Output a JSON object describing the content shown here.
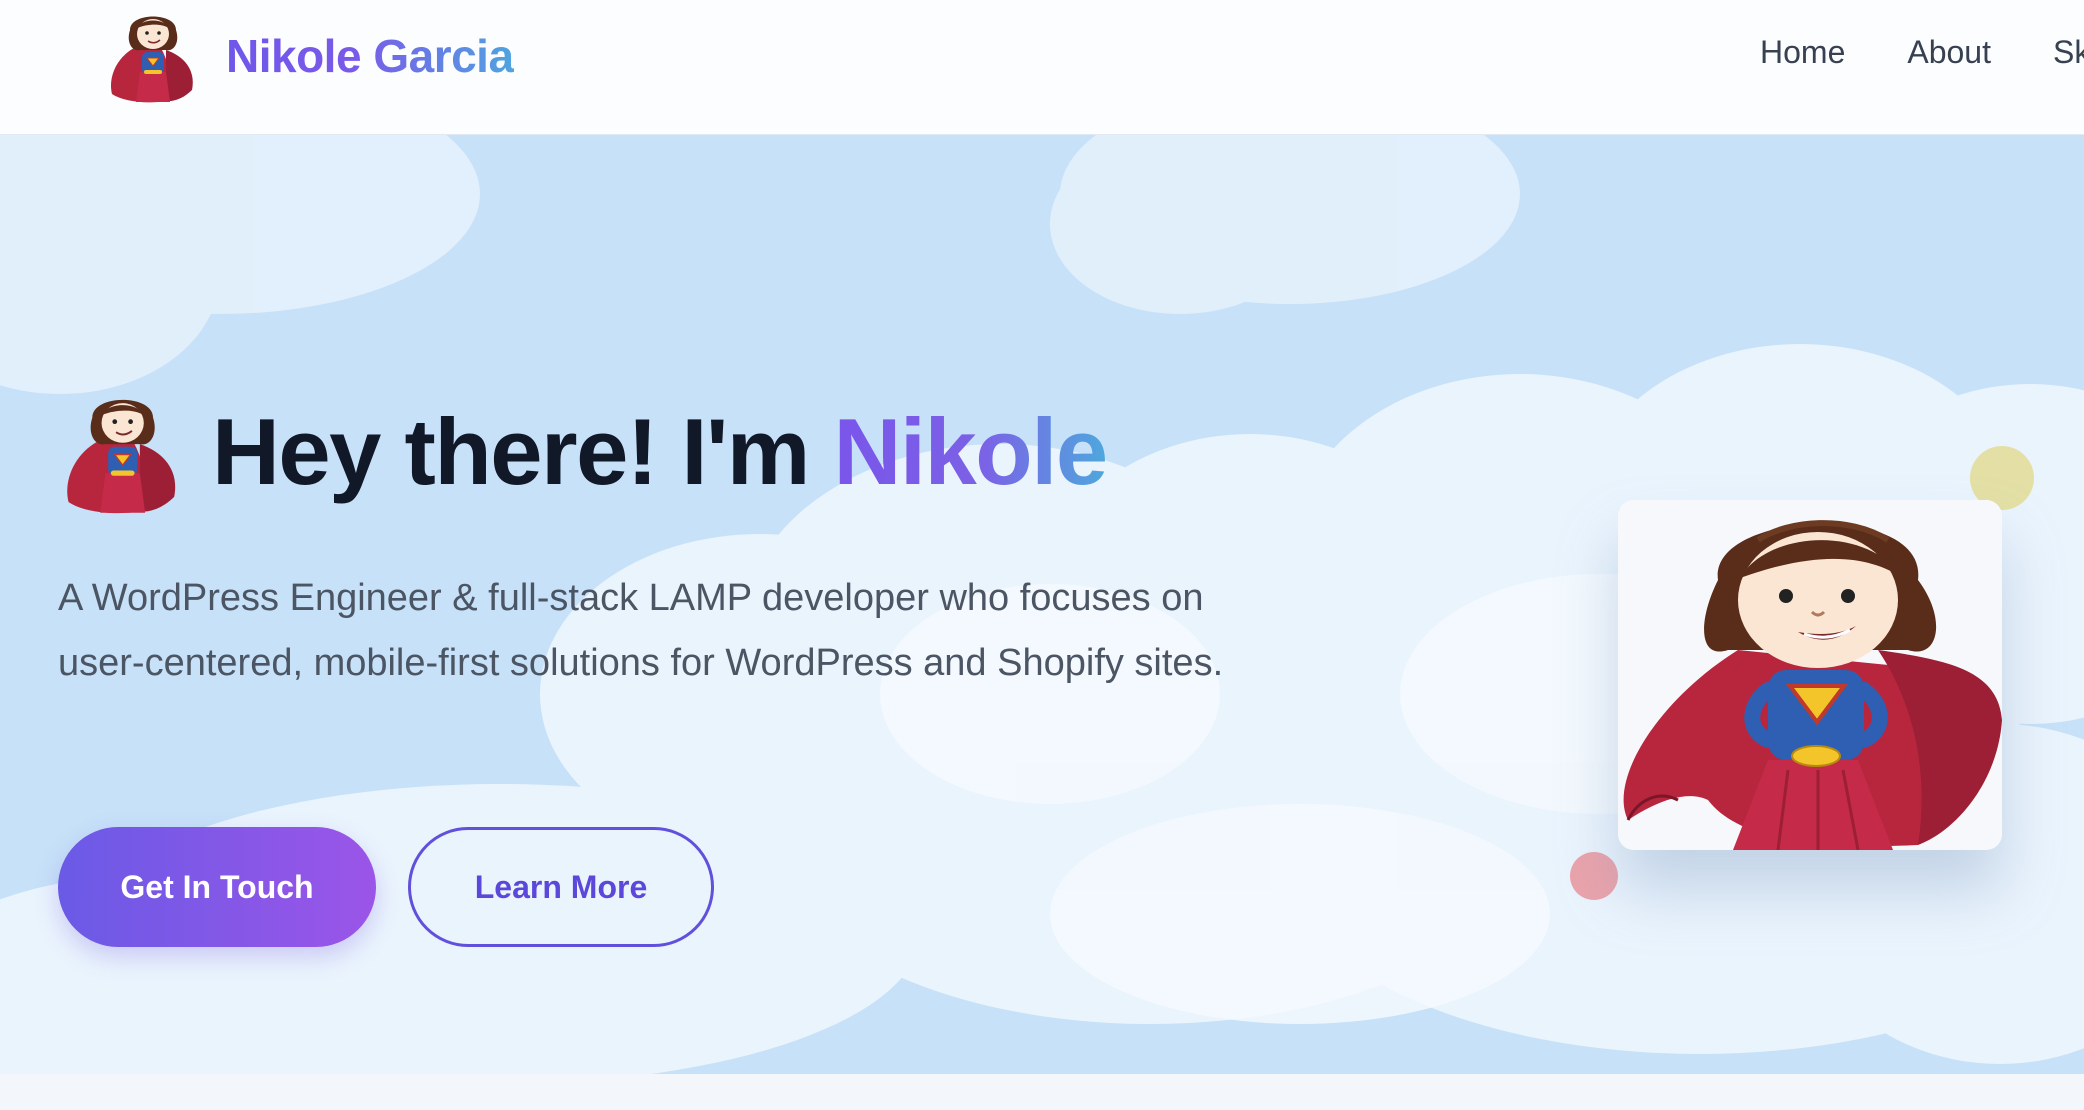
{
  "header": {
    "brand_name": "Nikole Garcia",
    "logo_icon": "superhero-mascot-icon",
    "nav": [
      {
        "label": "Home"
      },
      {
        "label": "About"
      },
      {
        "label": "Sk"
      }
    ]
  },
  "hero": {
    "title_prefix": "Hey there! I'm ",
    "title_name": "Nikole",
    "subtitle": "A WordPress Engineer & full-stack LAMP developer who focuses on user-centered, mobile-first solutions for WordPress and Shopify sites.",
    "primary_button": "Get In Touch",
    "secondary_button": "Learn More",
    "background": "sky-with-clouds"
  },
  "colors": {
    "brand_gradient_start": "#6f57ea",
    "brand_gradient_end": "#4fa4e0",
    "primary_button_start": "#6a5ae6",
    "primary_button_end": "#9b55e8",
    "outline_button": "#6150dc",
    "sky": "#c7e1f8",
    "heading": "#111827",
    "body_text": "#4b5563",
    "accent_dot_yellow": "#e4dea0",
    "accent_dot_pink": "#eaa3ab"
  }
}
